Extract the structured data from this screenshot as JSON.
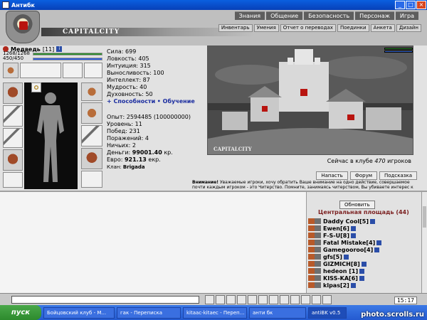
{
  "window": {
    "title": "Антибк"
  },
  "header": {
    "logo_text": "CAPITALCITY",
    "topnav": [
      "Знания",
      "Общение",
      "Безопасность",
      "Персонаж",
      "Игра"
    ],
    "subnav": [
      "Инвентарь",
      "Умения",
      "Отчет о переводах",
      "Поединки",
      "Анкета",
      "Дизайн"
    ]
  },
  "character": {
    "name": "Медведь",
    "level": "[11]",
    "hp": "1268/1268",
    "hp_fraction": 1.0,
    "mana": "450/450",
    "mana_fraction": 1.0
  },
  "stats": {
    "strength": "Сила: 699",
    "agility": "Ловкость: 405",
    "intuition": "Интуиция: 315",
    "endurance": "Выносливость: 100",
    "intellect": "Интеллект: 87",
    "wisdom": "Мудрость: 40",
    "spirit": "Духовность: 50",
    "abilities_link": "+ Способности",
    "training_link": "• Обучение",
    "experience": "Опыт: 2594485 (100000000)",
    "levels": "Уровень: 11",
    "wins": "Побед: 231",
    "losses": "Поражений: 4",
    "draws": "Ничьих: 2",
    "money_label": "Деньги:",
    "money_value": "99001.40",
    "money_unit": "кр.",
    "euro_label": "Евро:",
    "euro_value": "921.13",
    "euro_unit": "екр.",
    "clan_label": "Клан:",
    "clan_value": "Brigada"
  },
  "scene": {
    "caption": "CAPITALCITY",
    "online_prefix": "Сейчас в клубе",
    "online_count": "470",
    "online_suffix": "игроков",
    "buttons": [
      "Напасть",
      "Форум",
      "Подсказка"
    ]
  },
  "notice": {
    "label": "Внимание!",
    "text": "Уважаемые игроки, хочу обратить Ваше внимание на одно действие, совершаемое почти каждым игроком - это Читерство. Помните, занимаясь читерством, Вы убиваете интерес к"
  },
  "online_panel": {
    "refresh_label": "Обновить",
    "location": "Центральная площадь (44)",
    "players": [
      "Daddy Cool[5]",
      "Ewen[6]",
      "F-S-U[8]",
      "Fatal Mistake[4]",
      "Gamegooroo[4]",
      "gfs[5]",
      "GIZMICH[8]",
      "hedeon [1]",
      "KISS-KA[6]",
      "klpas[2]"
    ]
  },
  "toolbar": {
    "clock": "15:17"
  },
  "taskbar": {
    "start_label": "пуск",
    "tasks": [
      "Бойцовский клуб - М...",
      "гак - Переписка",
      "kitaac-kitaec - Переп...",
      "анти бк",
      "antiBK v0.5"
    ]
  },
  "watermark": "photo.scrolls.ru"
}
